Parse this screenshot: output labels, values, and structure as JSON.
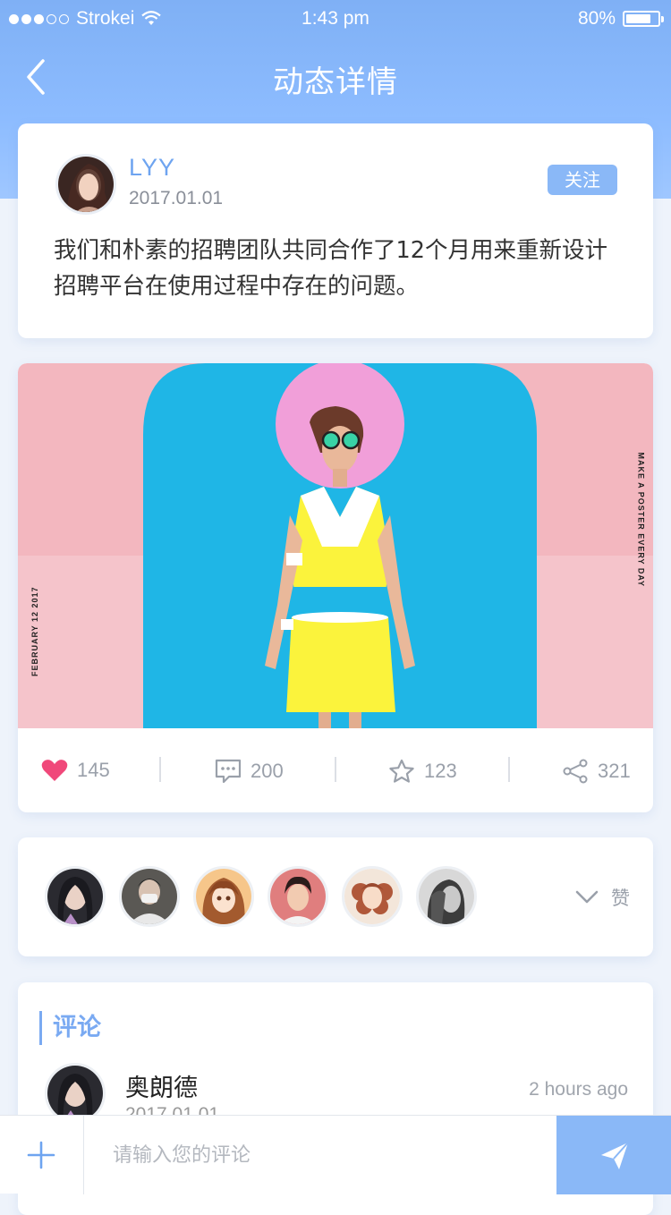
{
  "status_bar": {
    "carrier": "Strokei",
    "time": "1:43 pm",
    "battery": "80%",
    "battery_level": 0.8
  },
  "nav": {
    "title": "动态详情",
    "back_icon": "chevron-left-icon"
  },
  "post": {
    "username": "LYY",
    "date": "2017.01.01",
    "follow_label": "关注",
    "text": "我们和朴素的招聘团队共同合作了12个月用来重新设计招聘平台在使用过程中存在的问题。"
  },
  "poster": {
    "left_caption": "FEBRUARY 12 2017",
    "right_caption": "MAKE A POSTER EVERY DAY"
  },
  "stats": {
    "likes": "145",
    "comments": "200",
    "favorites": "123",
    "shares": "321"
  },
  "likes_panel": {
    "toggle_label": "赞",
    "liker_count": 6
  },
  "comments": {
    "section_title": "评论",
    "items": [
      {
        "name": "奥朗德",
        "date": "2017.01.01",
        "time": "2 hours ago"
      }
    ]
  },
  "composer": {
    "placeholder": "请输入您的评论",
    "plus_icon": "plus-icon",
    "send_icon": "send-icon"
  },
  "colors": {
    "accent": "#8ab8f7",
    "header": "#7fb0f5",
    "heart": "#f0487a"
  }
}
